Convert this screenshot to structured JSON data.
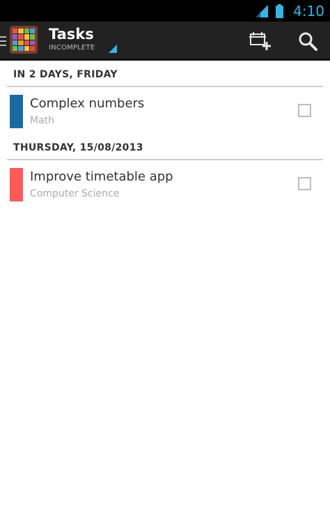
{
  "status_bar": {
    "time": "4:10",
    "icons": [
      "signal-icon",
      "battery-icon"
    ],
    "accent_color": "#33b5e5"
  },
  "action_bar": {
    "title": "Tasks",
    "subtitle": "INCOMPLETE",
    "icons": [
      "menu-indicator-icon",
      "app-icon",
      "add-task-icon",
      "search-icon"
    ]
  },
  "sections": [
    {
      "header": "IN 2 DAYS, FRIDAY",
      "tasks": [
        {
          "title": "Complex numbers",
          "subject": "Math",
          "color": "#1a6aa5",
          "completed": false
        }
      ]
    },
    {
      "header": "THURSDAY, 15/08/2013",
      "tasks": [
        {
          "title": "Improve timetable app",
          "subject": "Computer Science",
          "color": "#ff5a5a",
          "completed": false
        }
      ]
    }
  ]
}
